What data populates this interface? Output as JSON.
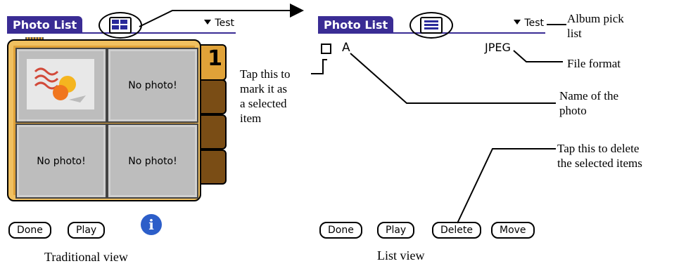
{
  "traditional": {
    "title": "Photo List",
    "album_name": "Test",
    "page_number": "1",
    "slots": [
      "",
      "No photo!",
      "No photo!",
      "No photo!"
    ],
    "buttons": {
      "done": "Done",
      "play": "Play"
    },
    "caption": "Traditional view"
  },
  "list": {
    "title": "Photo List",
    "album_name": "Test",
    "row": {
      "name": "A",
      "format": "JPEG"
    },
    "buttons": {
      "done": "Done",
      "play": "Play",
      "delete": "Delete",
      "move": "Move"
    },
    "caption": "List view"
  },
  "callouts": {
    "album_pick": [
      "Album pick",
      "list"
    ],
    "file_format": "File format",
    "name": [
      "Name of the",
      "photo"
    ],
    "mark": [
      "Tap this to",
      "mark it as",
      "a selected",
      "item"
    ],
    "delete": [
      "Tap this to delete",
      "the selected items"
    ]
  },
  "colors": {
    "title_bar": "#3a2c94",
    "album": "#e0a238",
    "album_tab": "#7a4d15",
    "info_button": "#2c5ec9"
  },
  "icons": [
    "view-grid-icon",
    "view-list-icon",
    "dropdown-triangle-icon",
    "info-icon"
  ]
}
